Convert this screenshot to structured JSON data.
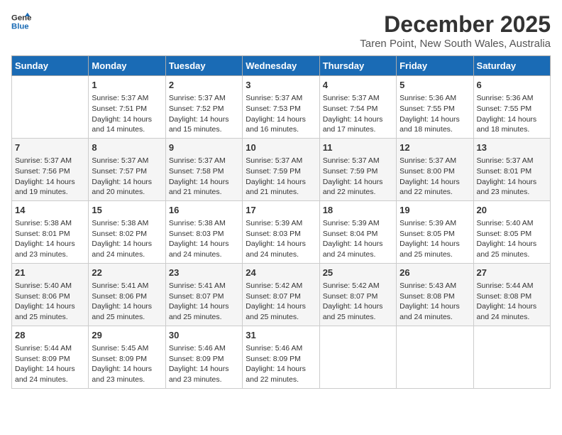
{
  "logo": {
    "line1": "General",
    "line2": "Blue"
  },
  "title": "December 2025",
  "subtitle": "Taren Point, New South Wales, Australia",
  "days_of_week": [
    "Sunday",
    "Monday",
    "Tuesday",
    "Wednesday",
    "Thursday",
    "Friday",
    "Saturday"
  ],
  "weeks": [
    [
      {
        "day": "",
        "content": ""
      },
      {
        "day": "1",
        "content": "Sunrise: 5:37 AM\nSunset: 7:51 PM\nDaylight: 14 hours\nand 14 minutes."
      },
      {
        "day": "2",
        "content": "Sunrise: 5:37 AM\nSunset: 7:52 PM\nDaylight: 14 hours\nand 15 minutes."
      },
      {
        "day": "3",
        "content": "Sunrise: 5:37 AM\nSunset: 7:53 PM\nDaylight: 14 hours\nand 16 minutes."
      },
      {
        "day": "4",
        "content": "Sunrise: 5:37 AM\nSunset: 7:54 PM\nDaylight: 14 hours\nand 17 minutes."
      },
      {
        "day": "5",
        "content": "Sunrise: 5:36 AM\nSunset: 7:55 PM\nDaylight: 14 hours\nand 18 minutes."
      },
      {
        "day": "6",
        "content": "Sunrise: 5:36 AM\nSunset: 7:55 PM\nDaylight: 14 hours\nand 18 minutes."
      }
    ],
    [
      {
        "day": "7",
        "content": "Sunrise: 5:37 AM\nSunset: 7:56 PM\nDaylight: 14 hours\nand 19 minutes."
      },
      {
        "day": "8",
        "content": "Sunrise: 5:37 AM\nSunset: 7:57 PM\nDaylight: 14 hours\nand 20 minutes."
      },
      {
        "day": "9",
        "content": "Sunrise: 5:37 AM\nSunset: 7:58 PM\nDaylight: 14 hours\nand 21 minutes."
      },
      {
        "day": "10",
        "content": "Sunrise: 5:37 AM\nSunset: 7:59 PM\nDaylight: 14 hours\nand 21 minutes."
      },
      {
        "day": "11",
        "content": "Sunrise: 5:37 AM\nSunset: 7:59 PM\nDaylight: 14 hours\nand 22 minutes."
      },
      {
        "day": "12",
        "content": "Sunrise: 5:37 AM\nSunset: 8:00 PM\nDaylight: 14 hours\nand 22 minutes."
      },
      {
        "day": "13",
        "content": "Sunrise: 5:37 AM\nSunset: 8:01 PM\nDaylight: 14 hours\nand 23 minutes."
      }
    ],
    [
      {
        "day": "14",
        "content": "Sunrise: 5:38 AM\nSunset: 8:01 PM\nDaylight: 14 hours\nand 23 minutes."
      },
      {
        "day": "15",
        "content": "Sunrise: 5:38 AM\nSunset: 8:02 PM\nDaylight: 14 hours\nand 24 minutes."
      },
      {
        "day": "16",
        "content": "Sunrise: 5:38 AM\nSunset: 8:03 PM\nDaylight: 14 hours\nand 24 minutes."
      },
      {
        "day": "17",
        "content": "Sunrise: 5:39 AM\nSunset: 8:03 PM\nDaylight: 14 hours\nand 24 minutes."
      },
      {
        "day": "18",
        "content": "Sunrise: 5:39 AM\nSunset: 8:04 PM\nDaylight: 14 hours\nand 24 minutes."
      },
      {
        "day": "19",
        "content": "Sunrise: 5:39 AM\nSunset: 8:05 PM\nDaylight: 14 hours\nand 25 minutes."
      },
      {
        "day": "20",
        "content": "Sunrise: 5:40 AM\nSunset: 8:05 PM\nDaylight: 14 hours\nand 25 minutes."
      }
    ],
    [
      {
        "day": "21",
        "content": "Sunrise: 5:40 AM\nSunset: 8:06 PM\nDaylight: 14 hours\nand 25 minutes."
      },
      {
        "day": "22",
        "content": "Sunrise: 5:41 AM\nSunset: 8:06 PM\nDaylight: 14 hours\nand 25 minutes."
      },
      {
        "day": "23",
        "content": "Sunrise: 5:41 AM\nSunset: 8:07 PM\nDaylight: 14 hours\nand 25 minutes."
      },
      {
        "day": "24",
        "content": "Sunrise: 5:42 AM\nSunset: 8:07 PM\nDaylight: 14 hours\nand 25 minutes."
      },
      {
        "day": "25",
        "content": "Sunrise: 5:42 AM\nSunset: 8:07 PM\nDaylight: 14 hours\nand 25 minutes."
      },
      {
        "day": "26",
        "content": "Sunrise: 5:43 AM\nSunset: 8:08 PM\nDaylight: 14 hours\nand 24 minutes."
      },
      {
        "day": "27",
        "content": "Sunrise: 5:44 AM\nSunset: 8:08 PM\nDaylight: 14 hours\nand 24 minutes."
      }
    ],
    [
      {
        "day": "28",
        "content": "Sunrise: 5:44 AM\nSunset: 8:09 PM\nDaylight: 14 hours\nand 24 minutes."
      },
      {
        "day": "29",
        "content": "Sunrise: 5:45 AM\nSunset: 8:09 PM\nDaylight: 14 hours\nand 23 minutes."
      },
      {
        "day": "30",
        "content": "Sunrise: 5:46 AM\nSunset: 8:09 PM\nDaylight: 14 hours\nand 23 minutes."
      },
      {
        "day": "31",
        "content": "Sunrise: 5:46 AM\nSunset: 8:09 PM\nDaylight: 14 hours\nand 22 minutes."
      },
      {
        "day": "",
        "content": ""
      },
      {
        "day": "",
        "content": ""
      },
      {
        "day": "",
        "content": ""
      }
    ]
  ]
}
